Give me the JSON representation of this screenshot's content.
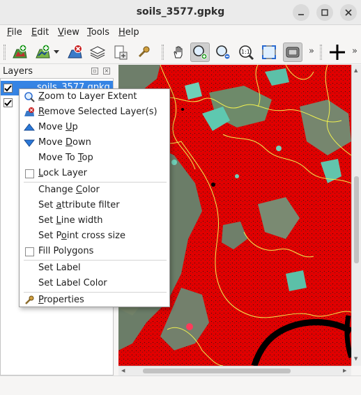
{
  "window": {
    "title": "soils_3577.gpkg"
  },
  "menubar": {
    "items": [
      {
        "label": "File",
        "mnemonic": "F",
        "rest": "ile"
      },
      {
        "label": "Edit",
        "mnemonic": "E",
        "rest": "dit"
      },
      {
        "label": "View",
        "mnemonic": "V",
        "rest": "iew"
      },
      {
        "label": "Tools",
        "mnemonic": "T",
        "rest": "ools"
      },
      {
        "label": "Help",
        "mnemonic": "H",
        "rest": "elp"
      }
    ]
  },
  "toolbar": {
    "icons": [
      "add-raster-layer-icon",
      "add-vector-layer-icon",
      "dropdown-arrow-icon",
      "remove-layer-icon",
      "layers-icon",
      "new-layer-icon",
      "properties-wrench-icon",
      "pan-hand-icon",
      "zoom-in-icon",
      "zoom-out-icon",
      "zoom-1to1-icon",
      "zoom-to-extent-icon",
      "full-screen-icon",
      "crosshair-icon"
    ],
    "active_tool": "zoom-in",
    "overflow_label": "»"
  },
  "layers_panel": {
    "title": "Layers",
    "layers": [
      {
        "name": "soils_3577.gpkg",
        "checked": true,
        "selected": true
      },
      {
        "name": "",
        "checked": true,
        "selected": false
      }
    ]
  },
  "context_menu": {
    "items": [
      {
        "label": "Zoom to Layer Extent",
        "pre": "",
        "mnemonic": "Z",
        "post": "oom to Layer Extent",
        "icon": "zoom-extent-icon"
      },
      {
        "label": "Remove Selected Layer(s)",
        "pre": "",
        "mnemonic": "R",
        "post": "emove Selected Layer(s)",
        "icon": "remove-layer-icon"
      },
      {
        "label": "Move Up",
        "pre": "Move ",
        "mnemonic": "U",
        "post": "p",
        "icon": "move-up-icon"
      },
      {
        "label": "Move Down",
        "pre": "Move ",
        "mnemonic": "D",
        "post": "own",
        "icon": "move-down-icon"
      },
      {
        "label": "Move To Top",
        "pre": "Move To ",
        "mnemonic": "T",
        "post": "op",
        "icon": ""
      },
      {
        "label": "Lock Layer",
        "pre": "",
        "mnemonic": "L",
        "post": "ock Layer",
        "checkbox": true,
        "checked": false
      },
      {
        "label": "Change Color",
        "pre": "Change ",
        "mnemonic": "C",
        "post": "olor",
        "icon": ""
      },
      {
        "label": "Set attribute filter",
        "pre": "Set ",
        "mnemonic": "a",
        "post": "ttribute filter",
        "icon": ""
      },
      {
        "label": "Set Line width",
        "pre": "Set ",
        "mnemonic": "L",
        "post": "ine width",
        "icon": ""
      },
      {
        "label": "Set Point cross size",
        "pre": "Set P",
        "mnemonic": "o",
        "post": "int cross size",
        "icon": ""
      },
      {
        "label": "Fill Polygons",
        "pre": "Fill Polygons",
        "mnemonic": "",
        "post": "",
        "checkbox": true,
        "checked": false
      },
      {
        "label": "Set Label",
        "pre": "Set Label",
        "mnemonic": "",
        "post": "",
        "icon": ""
      },
      {
        "label": "Set Label Color",
        "pre": "Set Label Color",
        "mnemonic": "",
        "post": "",
        "icon": ""
      },
      {
        "label": "Properties",
        "pre": "",
        "mnemonic": "P",
        "post": "roperties",
        "icon": "properties-wrench-icon"
      }
    ]
  },
  "colors": {
    "selection": "#3584e4",
    "map_fill": "#e00000",
    "map_outline": "#f0f050",
    "vegetation": "#6e8c6c"
  }
}
